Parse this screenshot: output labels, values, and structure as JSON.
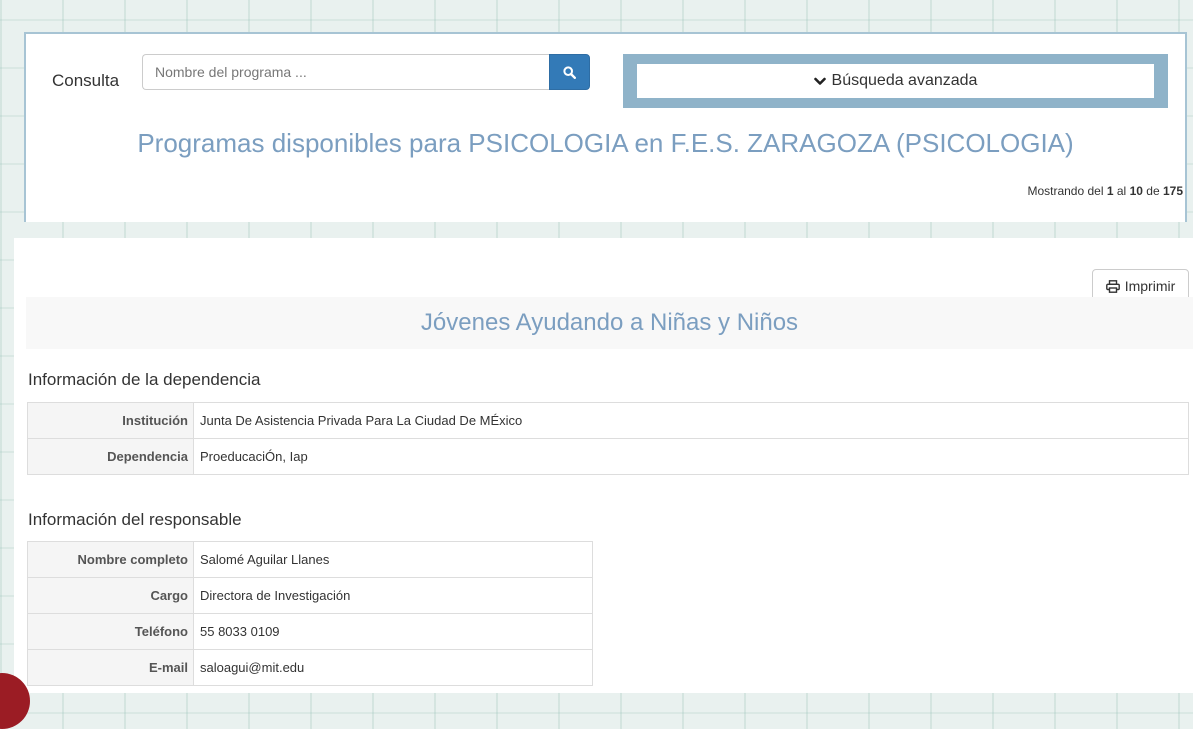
{
  "search": {
    "label": "Consulta",
    "placeholder": "Nombre del programa ...",
    "value": "",
    "button_icon": "search-icon",
    "advanced_label": "Búsqueda avanzada",
    "advanced_icon": "chevron-down-icon"
  },
  "panel": {
    "title": "Programas disponibles para PSICOLOGIA en F.E.S. ZARAGOZA (PSICOLOGIA)",
    "results": {
      "prefix": "Mostrando del",
      "from": "1",
      "middle": "al",
      "to": "10",
      "of_text": "de",
      "total": "175"
    }
  },
  "detail": {
    "print_label": "Imprimir",
    "print_icon": "printer-icon",
    "program_title": "Jóvenes Ayudando a Niñas y Niños",
    "dependency_section": {
      "heading": "Información de la dependencia",
      "rows": [
        {
          "key": "Institución",
          "value": "Junta De Asistencia Privada Para La Ciudad De MÉxico"
        },
        {
          "key": "Dependencia",
          "value": "ProeducaciÓn, Iap"
        }
      ]
    },
    "responsible_section": {
      "heading": "Información del responsable",
      "rows": [
        {
          "key": "Nombre completo",
          "value": "Salomé Aguilar Llanes"
        },
        {
          "key": "Cargo",
          "value": "Directora de Investigación"
        },
        {
          "key": "Teléfono",
          "value": "55 8033 0109"
        },
        {
          "key": "E-mail",
          "value": "saloagui@mit.edu"
        }
      ]
    }
  },
  "colors": {
    "accent_blue": "#337ab7",
    "title_blue": "#7b9ec0",
    "advanced_frame": "#8fb3c9"
  }
}
